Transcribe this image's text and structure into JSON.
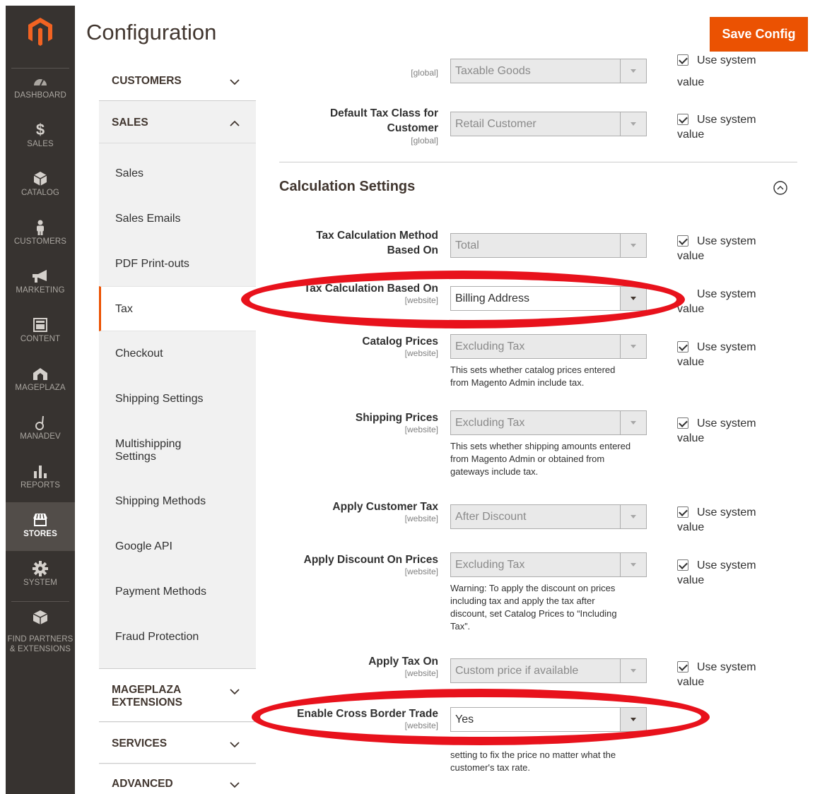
{
  "header": {
    "title": "Configuration",
    "save_label": "Save Config"
  },
  "admin_nav": [
    {
      "label": "DASHBOARD",
      "icon": "dashboard-icon"
    },
    {
      "label": "SALES",
      "icon": "dollar-icon"
    },
    {
      "label": "CATALOG",
      "icon": "box-icon"
    },
    {
      "label": "CUSTOMERS",
      "icon": "person-icon"
    },
    {
      "label": "MARKETING",
      "icon": "megaphone-icon"
    },
    {
      "label": "CONTENT",
      "icon": "layout-icon"
    },
    {
      "label": "MAGEPLAZA",
      "icon": "mageplaza-icon"
    },
    {
      "label": "MANADEV",
      "icon": "manadev-icon"
    },
    {
      "label": "REPORTS",
      "icon": "bar-chart-icon"
    },
    {
      "label": "STORES",
      "icon": "store-icon"
    },
    {
      "label": "SYSTEM",
      "icon": "gear-icon"
    },
    {
      "label_line1": "FIND PARTNERS",
      "label_line2": "& EXTENSIONS",
      "icon": "cube-icon"
    }
  ],
  "tabs": {
    "customers": "CUSTOMERS",
    "sales": "SALES",
    "sales_items": [
      "Sales",
      "Sales Emails",
      "PDF Print-outs",
      "Tax",
      "Checkout",
      "Shipping Settings",
      "Multishipping",
      "Settings",
      "Shipping Methods",
      "Google API",
      "Payment Methods",
      "Fraud Protection"
    ],
    "mageplaza_line1": "MAGEPLAZA",
    "mageplaza_line2": "EXTENSIONS",
    "services": "SERVICES",
    "advanced": "ADVANCED"
  },
  "use_system": {
    "line1": "Use system",
    "line2": "value"
  },
  "fields_top": [
    {
      "label": "",
      "scope": "[global]",
      "value": "Taxable Goods"
    },
    {
      "label_line1": "Default Tax Class for",
      "label_line2": "Customer",
      "scope": "[global]",
      "value": "Retail Customer"
    }
  ],
  "section": {
    "title": "Calculation Settings"
  },
  "fields": {
    "method": {
      "label_line1": "Tax Calculation Method",
      "label_line2": "Based On",
      "value": "Total"
    },
    "based_on": {
      "label": "Tax Calculation Based On",
      "scope": "[website]",
      "value": "Billing Address"
    },
    "catalog": {
      "label": "Catalog Prices",
      "scope": "[website]",
      "value": "Excluding Tax",
      "note_line1": "This sets whether catalog prices entered",
      "note_line2": "from Magento Admin include tax."
    },
    "shipping": {
      "label": "Shipping Prices",
      "scope": "[website]",
      "value": "Excluding Tax",
      "note_line1": "This sets whether shipping amounts entered",
      "note_line2": "from Magento Admin or obtained from",
      "note_line3": "gateways include tax."
    },
    "apply_customer": {
      "label": "Apply Customer Tax",
      "scope": "[website]",
      "value": "After Discount"
    },
    "apply_discount": {
      "label": "Apply Discount On Prices",
      "scope": "[website]",
      "value": "Excluding Tax",
      "note_line1": "Warning: To apply the discount on prices",
      "note_line2": "including tax and apply the tax after",
      "note_line3": "discount, set Catalog Prices to “Including",
      "note_line4": "Tax”."
    },
    "apply_tax_on": {
      "label": "Apply Tax On",
      "scope": "[website]",
      "value": "Custom price if available"
    },
    "cross_border": {
      "label": "Enable Cross Border Trade",
      "scope": "[website]",
      "value": "Yes",
      "note_line1": "setting to fix the price no matter what the",
      "note_line2": "customer's tax rate."
    }
  },
  "colors": {
    "accent": "#eb5202",
    "annotation": "#e8121c",
    "nav_bg": "#373330"
  }
}
